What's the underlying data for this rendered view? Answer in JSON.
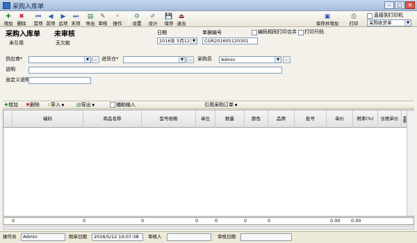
{
  "window": {
    "title": "采购入库单"
  },
  "toolbar": {
    "buttons": [
      {
        "label": "增加",
        "icon": "add-icon",
        "color": "#2a8a2a",
        "glyph": "✚"
      },
      {
        "label": "删除",
        "icon": "delete-icon",
        "color": "#c62020",
        "glyph": "✖"
      },
      {
        "label": "首项",
        "icon": "first-icon",
        "color": "#2a5fb0",
        "glyph": "⏮"
      },
      {
        "label": "前项",
        "icon": "prev-icon",
        "color": "#2a5fb0",
        "glyph": "◀"
      },
      {
        "label": "后项",
        "icon": "next-icon",
        "color": "#2a5fb0",
        "glyph": "▶"
      },
      {
        "label": "末项",
        "icon": "last-icon",
        "color": "#2a5fb0",
        "glyph": "⏭"
      },
      {
        "label": "导出",
        "icon": "export-icon",
        "color": "#1f7a3a",
        "glyph": "▤"
      },
      {
        "label": "审核",
        "icon": "audit-icon",
        "color": "#7a4a1a",
        "glyph": "✎"
      },
      {
        "label": "操作",
        "icon": "operate-icon",
        "color": "#c08a10",
        "glyph": "⚡"
      },
      {
        "label": "设置",
        "icon": "settings-icon",
        "color": "#2f8a8a",
        "glyph": "⚙"
      },
      {
        "label": "设计",
        "icon": "design-icon",
        "color": "#5a6fb0",
        "glyph": "✐"
      },
      {
        "label": "保存",
        "icon": "save-icon",
        "color": "#2a4fb0",
        "glyph": "💾"
      },
      {
        "label": "退出",
        "icon": "exit-icon",
        "color": "#8a2a2a",
        "glyph": "⏏"
      },
      {
        "label": "保存并增加",
        "icon": "save-add-icon",
        "color": "#2a4fb0",
        "glyph": "▣"
      },
      {
        "label": "打印",
        "icon": "print-icon",
        "color": "#444444",
        "glyph": "⎙"
      }
    ],
    "direct_print_label": "直接到打印机",
    "print_template": "采购收货单"
  },
  "header": {
    "doc_title": "采购入库单",
    "audit_status": "未审核",
    "ref_status": "未引用",
    "debt_status": "无欠款",
    "date_label": "日期",
    "date_value": "2016年 5月12日",
    "doc_no_label": "单据编号",
    "doc_no_value": "CGR201605120301",
    "merge_print_label": "编码相同打印合并",
    "print_barcode_label": "打印尺码"
  },
  "form": {
    "supplier_label": "供应商*",
    "supplier_value": "",
    "warehouse_label": "进货仓*",
    "warehouse_value": "",
    "buyer_label": "采购员",
    "buyer_value": "Admin",
    "remark_label": "说明",
    "remark_value": "",
    "custom_label": "自定义说明",
    "custom_value": ""
  },
  "grid_toolbar": {
    "add": "增加",
    "delete": "删除",
    "import": "导入",
    "export": "导出",
    "assist_input": "辅助输入",
    "ref_order": "引用采购订单"
  },
  "grid": {
    "columns": [
      "编码",
      "商品名称",
      "型号规格",
      "单位",
      "数量",
      "颜色",
      "品牌",
      "批号",
      "单价",
      "税率(%)",
      "含税单价",
      "金额"
    ],
    "totals": [
      "0",
      "0",
      "0",
      "0",
      "0",
      "0",
      "0",
      "0.00",
      "0.00"
    ]
  },
  "status": {
    "operator_label": "操作员",
    "operator_value": "Admin",
    "make_date_label": "制单日期",
    "make_date_value": "2016/5/12 10:07:38",
    "auditor_label": "审核人",
    "auditor_value": "",
    "audit_date_label": "审核日期",
    "audit_date_value": ""
  }
}
